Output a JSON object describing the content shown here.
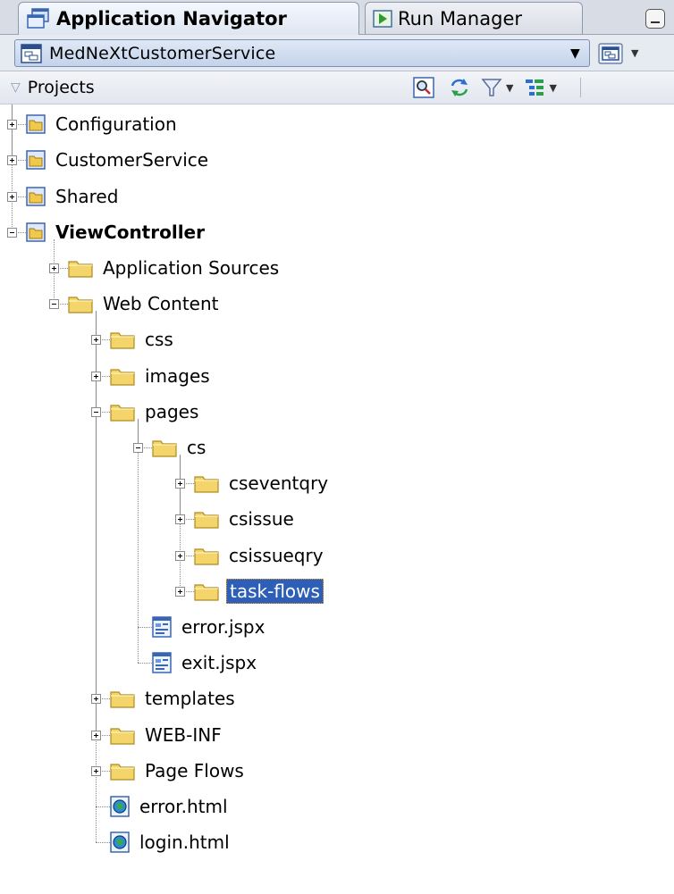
{
  "tabs": {
    "active_label": "Application Navigator",
    "inactive_label": "Run Manager"
  },
  "app_selector": {
    "value": "MedNeXtCustomerService"
  },
  "projects_header": {
    "label": "Projects"
  },
  "tree": [
    {
      "label": "Configuration",
      "icon": "project-icon",
      "level": 0,
      "expander": "plus"
    },
    {
      "label": "CustomerService",
      "icon": "project-icon",
      "level": 0,
      "expander": "plus"
    },
    {
      "label": "Shared",
      "icon": "project-icon",
      "level": 0,
      "expander": "plus"
    },
    {
      "label": "ViewController",
      "icon": "project-icon",
      "level": 0,
      "expander": "minus",
      "bold": true
    },
    {
      "label": "Application Sources",
      "icon": "folder-icon",
      "level": 1,
      "expander": "plus"
    },
    {
      "label": "Web Content",
      "icon": "folder-icon",
      "level": 1,
      "expander": "minus"
    },
    {
      "label": "css",
      "icon": "folder-icon",
      "level": 2,
      "expander": "plus"
    },
    {
      "label": "images",
      "icon": "folder-icon",
      "level": 2,
      "expander": "plus"
    },
    {
      "label": "pages",
      "icon": "folder-icon",
      "level": 2,
      "expander": "minus"
    },
    {
      "label": "cs",
      "icon": "folder-icon",
      "level": 3,
      "expander": "minus"
    },
    {
      "label": "cseventqry",
      "icon": "folder-icon",
      "level": 4,
      "expander": "plus"
    },
    {
      "label": "csissue",
      "icon": "folder-icon",
      "level": 4,
      "expander": "plus"
    },
    {
      "label": "csissueqry",
      "icon": "folder-icon",
      "level": 4,
      "expander": "plus"
    },
    {
      "label": "task-flows",
      "icon": "folder-icon",
      "level": 4,
      "expander": "plus",
      "selected": true
    },
    {
      "label": "error.jspx",
      "icon": "jspx-file-icon",
      "level": 3,
      "expander": "none"
    },
    {
      "label": "exit.jspx",
      "icon": "jspx-file-icon",
      "level": 3,
      "expander": "none"
    },
    {
      "label": "templates",
      "icon": "folder-icon",
      "level": 2,
      "expander": "plus"
    },
    {
      "label": "WEB-INF",
      "icon": "folder-icon",
      "level": 2,
      "expander": "plus"
    },
    {
      "label": "Page Flows",
      "icon": "folder-icon",
      "level": 2,
      "expander": "plus"
    },
    {
      "label": "error.html",
      "icon": "html-file-icon",
      "level": 2,
      "expander": "none"
    },
    {
      "label": "login.html",
      "icon": "html-file-icon",
      "level": 2,
      "expander": "none"
    }
  ],
  "colors": {
    "selection": "#2e5fb8",
    "folder": "#f3d56b",
    "project": "#f0c94a"
  }
}
